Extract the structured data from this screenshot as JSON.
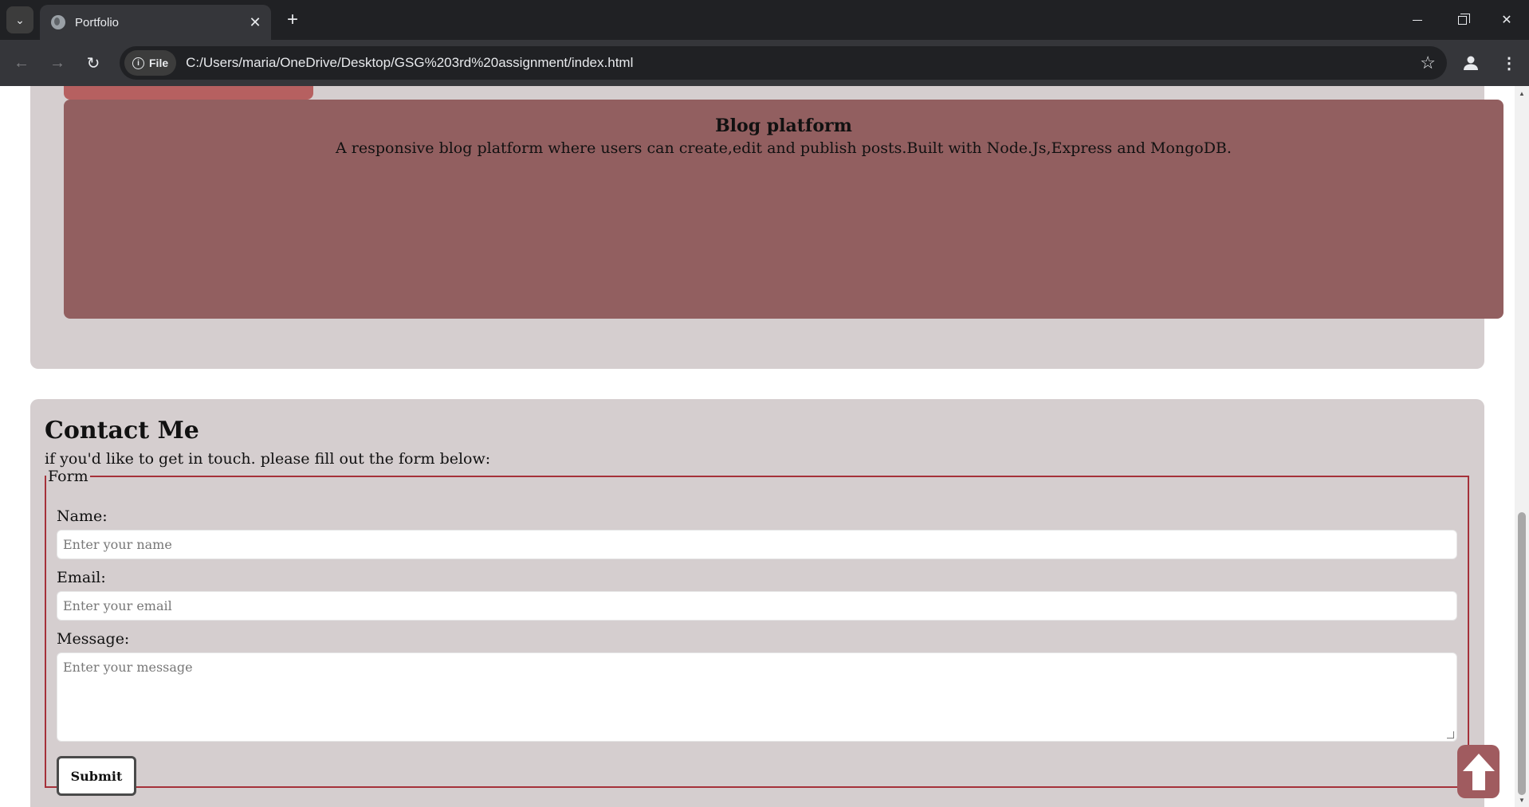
{
  "browser": {
    "tab_title": "Portfolio",
    "new_tab_symbol": "+",
    "close_symbol": "✕",
    "file_chip_label": "File",
    "url": "C:/Users/maria/OneDrive/Desktop/GSG%203rd%20assignment/index.html"
  },
  "projects": {
    "blog_card": {
      "title": "Blog platform",
      "description": "A responsive blog platform where users can create,edit and publish posts.Built with Node.Js,Express and MongoDB."
    }
  },
  "contact": {
    "title": "Contact Me",
    "intro": "if you'd like to get in touch. please fill out the form below:",
    "form_legend": "Form",
    "name_label": "Name:",
    "name_placeholder": "Enter your name",
    "email_label": "Email:",
    "email_placeholder": "Enter your email",
    "message_label": "Message:",
    "message_placeholder": "Enter your message",
    "submit_label": "Submit"
  },
  "colors": {
    "chrome_dark": "#202124",
    "chrome_toolbar": "#35363a",
    "section_bg": "#d5cecf",
    "card_partial": "#b66060",
    "card_blog": "#925f60",
    "fieldset_border": "#a5313a",
    "to_top_button": "#a05b5f"
  },
  "icons": {
    "tab_menu": "chevron-down-icon",
    "favicon": "globe-icon",
    "back": "arrow-left-icon",
    "forward": "arrow-right-icon",
    "reload": "reload-icon",
    "info": "info-icon",
    "bookmark": "star-icon",
    "profile": "profile-icon",
    "menu": "kebab-menu-icon",
    "to_top": "arrow-up-icon"
  }
}
